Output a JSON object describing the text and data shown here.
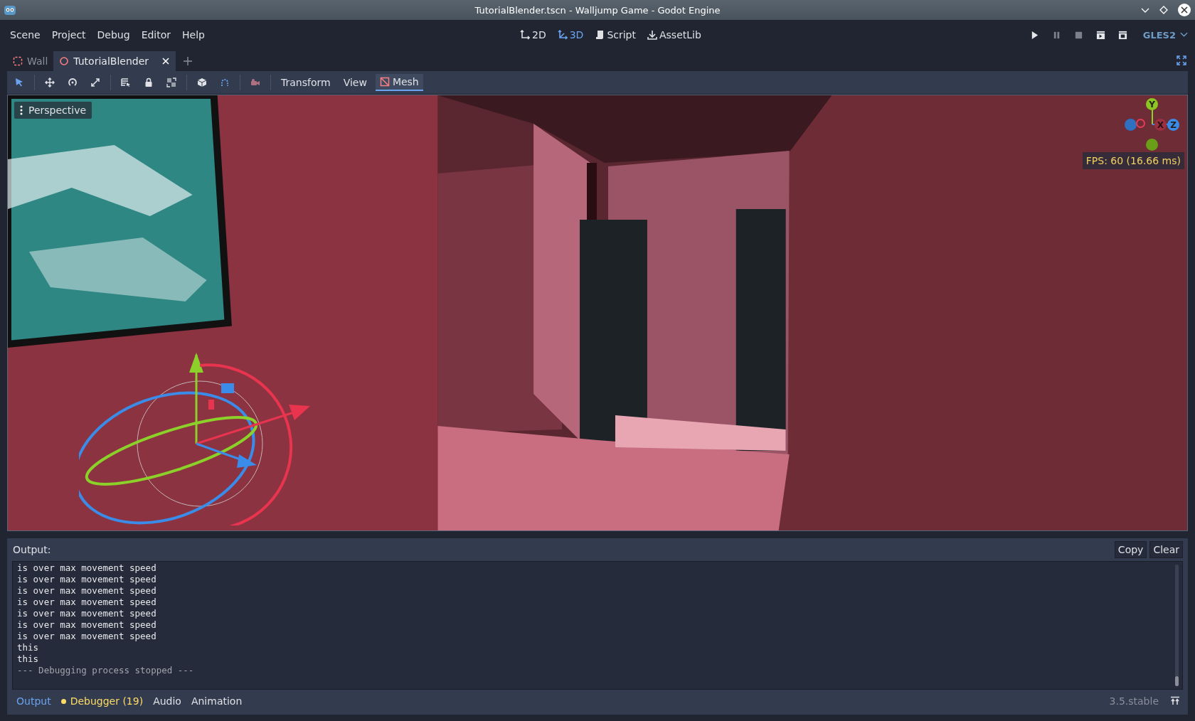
{
  "window": {
    "title": "TutorialBlender.tscn - Walljump Game - Godot Engine"
  },
  "menu": [
    "Scene",
    "Project",
    "Debug",
    "Editor",
    "Help"
  ],
  "workspaces": [
    {
      "kind": "planar",
      "label": "2D",
      "selected": false
    },
    {
      "kind": "spatial",
      "label": "3D",
      "selected": true
    },
    {
      "kind": "script",
      "label": "Script",
      "selected": false
    },
    {
      "kind": "assetlib",
      "label": "AssetLib",
      "selected": false
    }
  ],
  "run_controls": [
    {
      "kind": "play",
      "disabled": false
    },
    {
      "kind": "pause",
      "disabled": true
    },
    {
      "kind": "stop",
      "disabled": true
    },
    {
      "kind": "scene",
      "disabled": false
    },
    {
      "kind": "custom",
      "disabled": false
    }
  ],
  "renderer": "GLES2",
  "scene_tabs": [
    {
      "kind": "planar",
      "label": "Wall",
      "selected": false
    },
    {
      "kind": "spatial",
      "label": "TutorialBlender",
      "selected": true
    }
  ],
  "tools": [
    {
      "kind": "select",
      "selected": true
    },
    {
      "kind": "move",
      "selected": false
    },
    {
      "kind": "rotate",
      "selected": false
    },
    {
      "kind": "scale",
      "selected": false
    },
    {
      "kind": "list",
      "selected": false
    },
    {
      "kind": "lock",
      "selected": false
    },
    {
      "kind": "group",
      "selected": false
    },
    {
      "kind": "local",
      "selected": false
    },
    {
      "kind": "snap",
      "selected": false
    },
    {
      "kind": "camera",
      "selected": false
    }
  ],
  "toolbar_menus": [
    {
      "label": "Transform",
      "selected": false
    },
    {
      "label": "View",
      "selected": false
    },
    {
      "label": "Mesh",
      "selected": true
    }
  ],
  "viewport": {
    "view_label": "Perspective",
    "fps": "FPS: 60 (16.66 ms)",
    "axes": [
      {
        "kind": "y",
        "label": "Y"
      },
      {
        "kind": "x",
        "label": "X"
      },
      {
        "kind": "z",
        "label": "Z"
      }
    ]
  },
  "output": {
    "title": "Output:",
    "buttons": [
      "Copy",
      "Clear"
    ],
    "lines": [
      {
        "kind": "print",
        "text": "is over max movement speed"
      },
      {
        "kind": "print",
        "text": "is over max movement speed"
      },
      {
        "kind": "print",
        "text": "is over max movement speed"
      },
      {
        "kind": "print",
        "text": "is over max movement speed"
      },
      {
        "kind": "print",
        "text": "is over max movement speed"
      },
      {
        "kind": "print",
        "text": "is over max movement speed"
      },
      {
        "kind": "print",
        "text": "is over max movement speed"
      },
      {
        "kind": "print",
        "text": "this"
      },
      {
        "kind": "print",
        "text": "this"
      },
      {
        "kind": "system",
        "text": "--- Debugging process stopped ---"
      }
    ]
  },
  "bottom_tabs": [
    {
      "label": "Output",
      "selected": true
    },
    {
      "label": "Debugger (19)",
      "selected": false,
      "color": "#ffdd65"
    },
    {
      "label": "Audio",
      "selected": false
    },
    {
      "label": "Animation",
      "selected": false
    }
  ],
  "version": "3.5.stable"
}
